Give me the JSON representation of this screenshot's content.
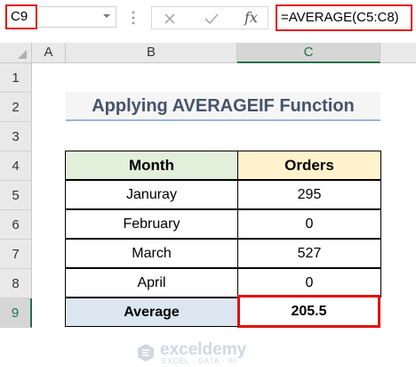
{
  "formula_bar": {
    "name_box": "C9",
    "formula": "=AVERAGE(C5:C8)",
    "fx_label": "fx"
  },
  "columns": [
    "A",
    "B",
    "C"
  ],
  "rows": [
    "1",
    "2",
    "3",
    "4",
    "5",
    "6",
    "7",
    "8",
    "9"
  ],
  "title": "Applying AVERAGEIF Function",
  "table": {
    "headers": {
      "month": "Month",
      "orders": "Orders"
    },
    "rows": [
      {
        "month": "Januray",
        "orders": "295"
      },
      {
        "month": "February",
        "orders": "0"
      },
      {
        "month": "March",
        "orders": "527"
      },
      {
        "month": "April",
        "orders": "0"
      }
    ],
    "average_label": "Average",
    "average_value": "205.5"
  },
  "watermark": {
    "name": "exceldemy",
    "tagline": "EXCEL · DATA · BI"
  },
  "colors": {
    "highlight": "#e01010",
    "excel_green": "#1e7145",
    "month_header_bg": "#e2efda",
    "orders_header_bg": "#fff2cc",
    "average_bg": "#dce6f1",
    "title_text": "#44546a"
  }
}
